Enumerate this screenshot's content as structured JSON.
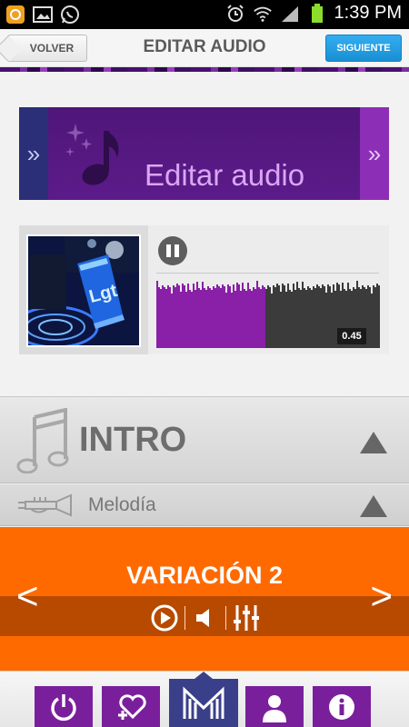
{
  "status_bar": {
    "time": "1:39 PM",
    "icons": [
      "notification-icon",
      "gallery-icon",
      "whatsapp-icon",
      "alarm-icon",
      "wifi-icon",
      "signal-icon",
      "battery-icon"
    ]
  },
  "topnav": {
    "back_label": "VOLVER",
    "title": "EDITAR AUDIO",
    "next_label": "SIGUIENTE"
  },
  "banner": {
    "title": "Editar audio",
    "left_icon": "double-chevron-right-icon",
    "right_icon": "double-chevron-right-icon",
    "icon": "music-note-sparkle-icon"
  },
  "player": {
    "state": "playing",
    "control_icon": "pause-icon",
    "position": "0.45",
    "progress_fraction": 0.49,
    "thumbnail": "album-cover-image"
  },
  "intro": {
    "title": "INTRO",
    "icon": "music-notes-icon",
    "toggle_icon": "triangle-up-icon"
  },
  "melodia": {
    "label": "Melodía",
    "icon": "trumpet-icon",
    "toggle_icon": "triangle-up-icon"
  },
  "variation": {
    "title": "VARIACIÓN 2",
    "prev": "<",
    "next": ">",
    "controls": [
      "play-icon",
      "volume-icon",
      "equalizer-icon"
    ]
  },
  "bottom_bar": {
    "items": [
      "power-icon",
      "add-favorite-icon",
      "mixer-logo-icon",
      "profile-icon",
      "info-icon"
    ],
    "active_index": 2
  },
  "colors": {
    "accent_orange": "#ff6a00",
    "accent_purple": "#7a1f9c",
    "next_blue": "#1a8fd4",
    "banner_text": "#d9a6f5"
  }
}
